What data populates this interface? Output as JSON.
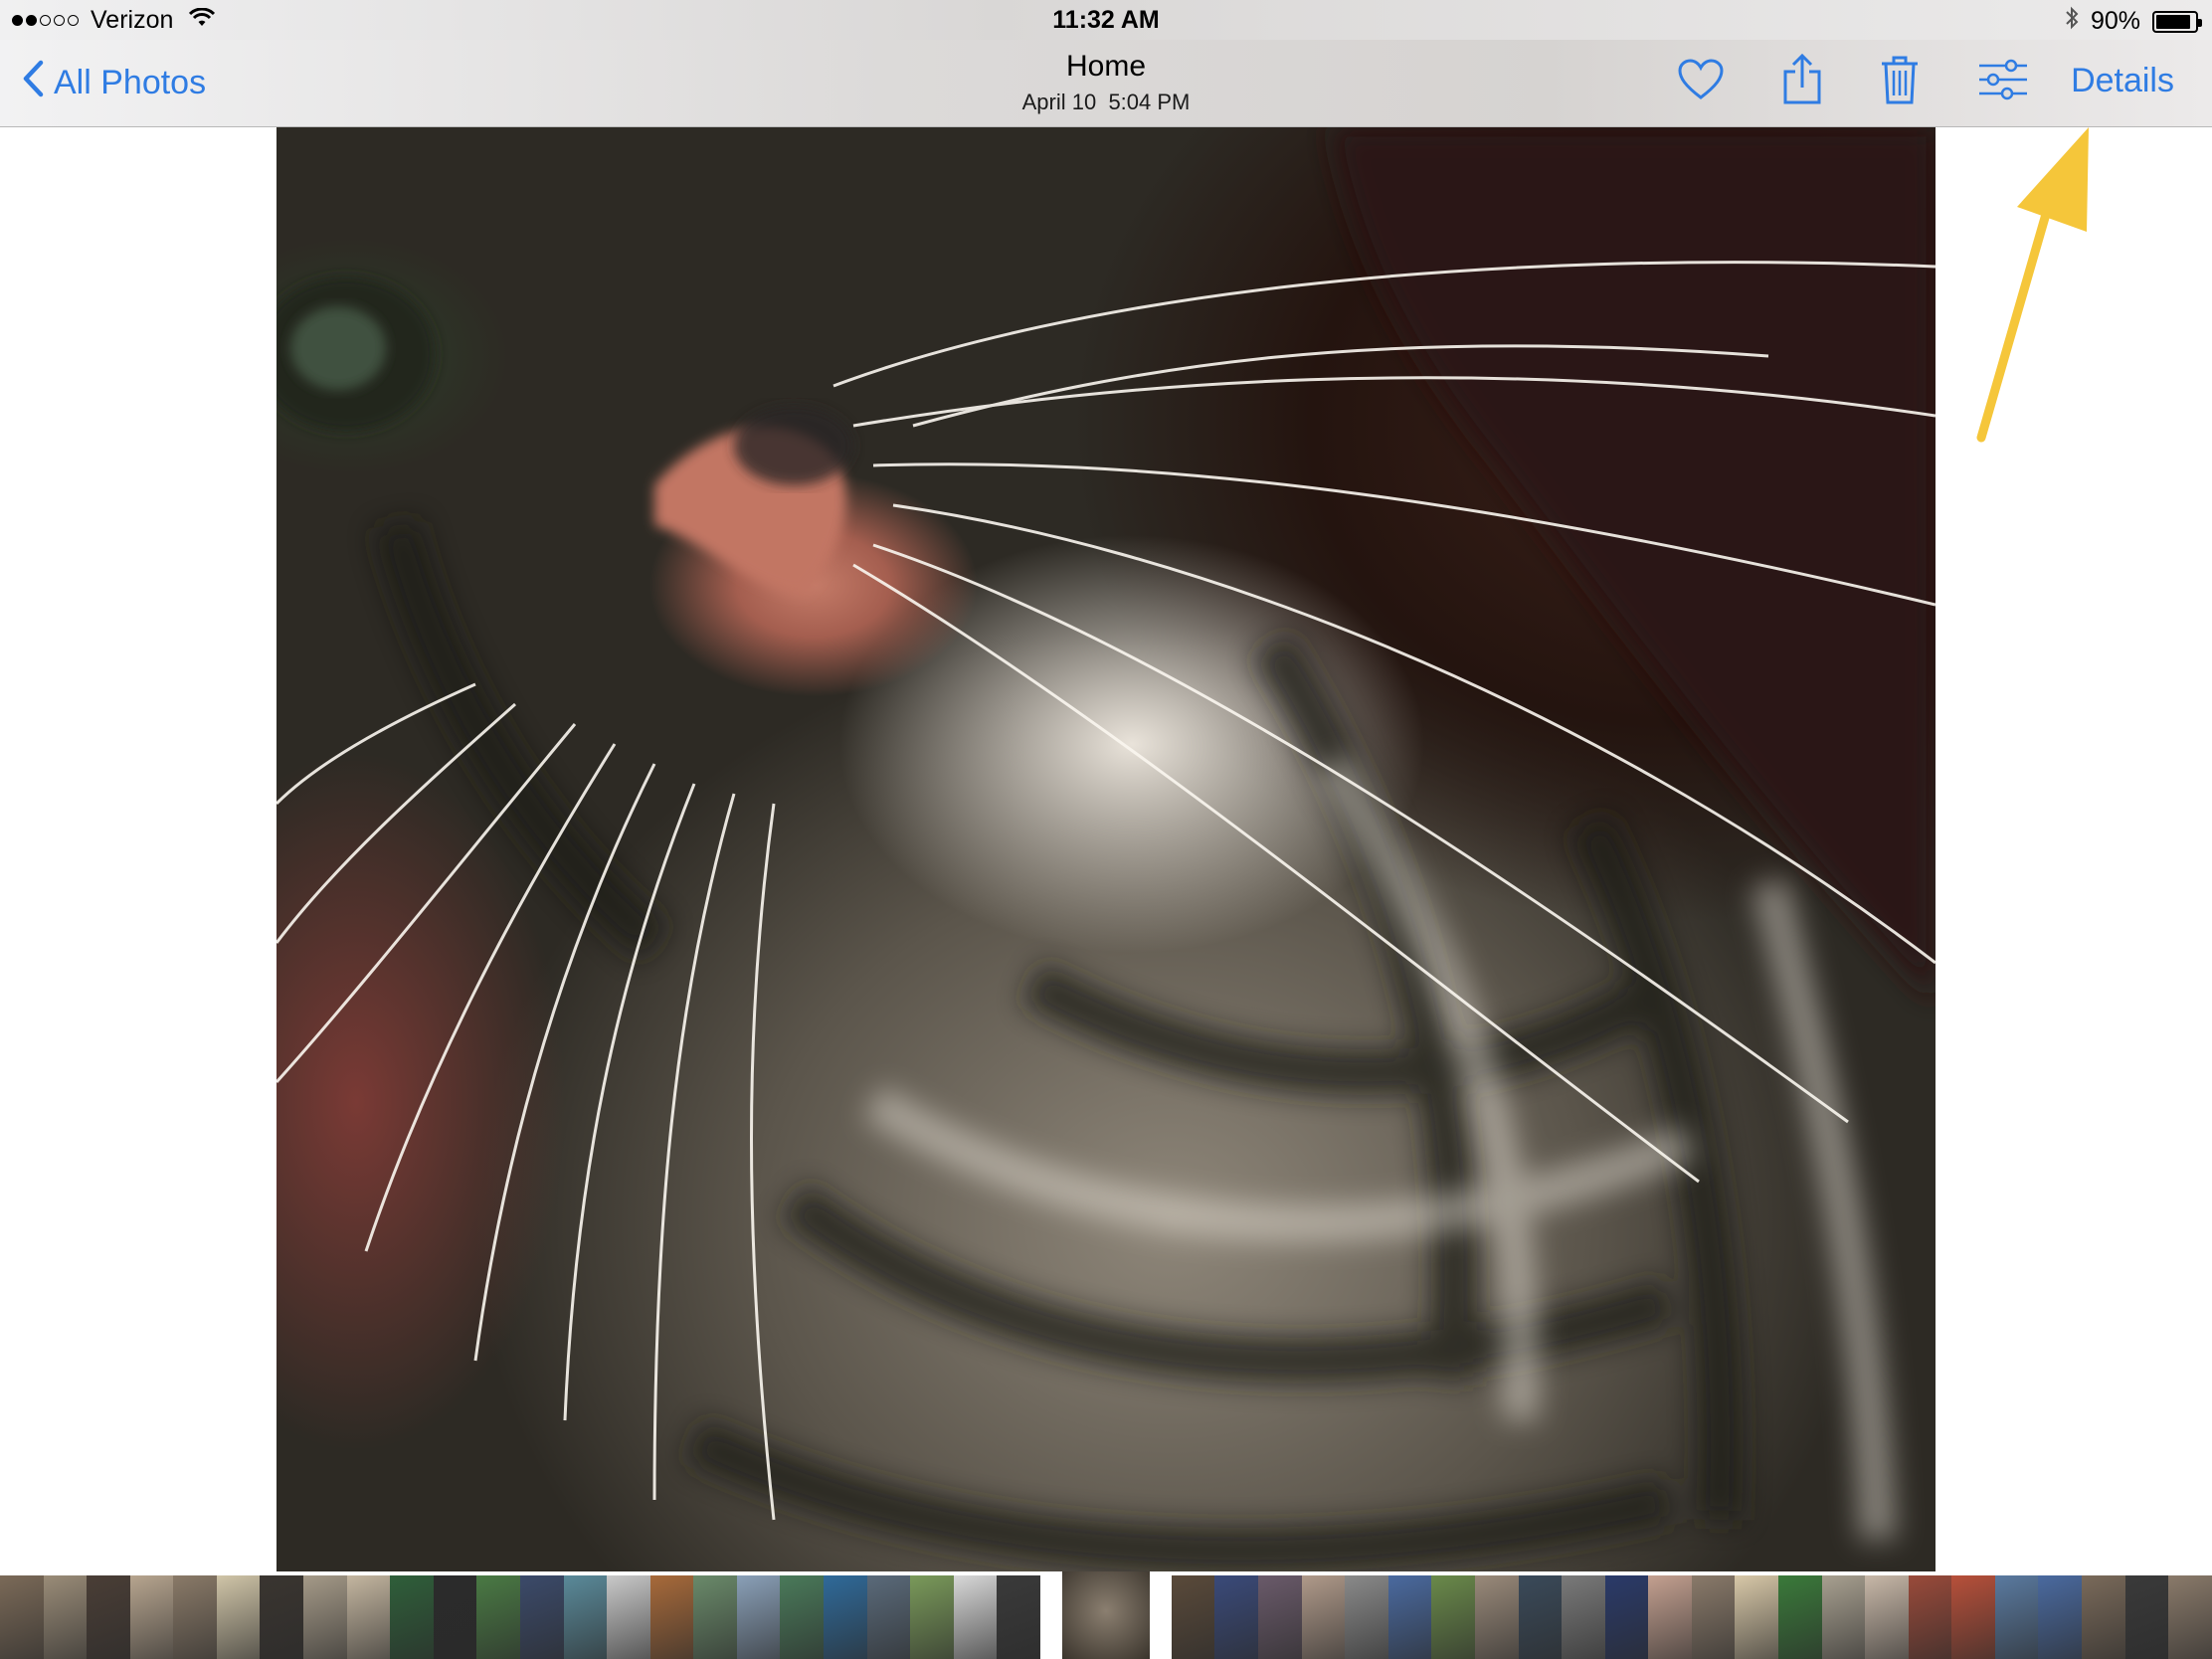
{
  "status_bar": {
    "carrier": "Verizon",
    "signal_full": 2,
    "signal_total": 5,
    "time": "11:32 AM",
    "battery_percent_label": "90%",
    "battery_level": 0.9,
    "icons": [
      "wifi-icon",
      "bluetooth-icon",
      "battery-icon"
    ]
  },
  "nav": {
    "back_label": "All Photos",
    "title": "Home",
    "subtitle": "April 10  5:04 PM",
    "details_label": "Details",
    "accent_color": "#2f7ce3",
    "toolbar_icons": [
      "heart-icon",
      "share-icon",
      "trash-icon",
      "adjust-icon"
    ]
  },
  "photo": {
    "subject": "cat-closeup"
  },
  "annotation": {
    "color": "#f5c63a",
    "points_to": "details-button"
  },
  "filmstrip": {
    "selected_index": 24,
    "thumbnail_colors": [
      "#7b6a58",
      "#9a8c78",
      "#4a3e36",
      "#b7a58f",
      "#8a7a68",
      "#d0c5a8",
      "#3a3530",
      "#a59a88",
      "#c4b6a0",
      "#2f5f3a",
      "#2b2b2b",
      "#4a7a44",
      "#3b4a6a",
      "#5a8a9a",
      "#c9c9c9",
      "#a86a3a",
      "#6a8a6a",
      "#8aa0b8",
      "#4a7a5a",
      "#2f6a9a",
      "#5a6a7a",
      "#7a9a5a",
      "#d8d8d8",
      "#3a3a3a",
      "#8b7f70",
      "#5a4a3a",
      "#3a4a7a",
      "#6a5a6a",
      "#b09a8a",
      "#8a8a8a",
      "#4a6aa0",
      "#6a8a4a",
      "#9a8a7a",
      "#3a4a5a",
      "#7a7a7a",
      "#2a3a6a",
      "#c4a090",
      "#8a7a6a",
      "#d8c8a8",
      "#3a7a3a",
      "#a8a090",
      "#c8b8a8",
      "#9a4a3a",
      "#b8503a",
      "#5a7aa0",
      "#4a6aa0",
      "#7a6a5a",
      "#3a3a3a",
      "#8a7a6a"
    ]
  }
}
